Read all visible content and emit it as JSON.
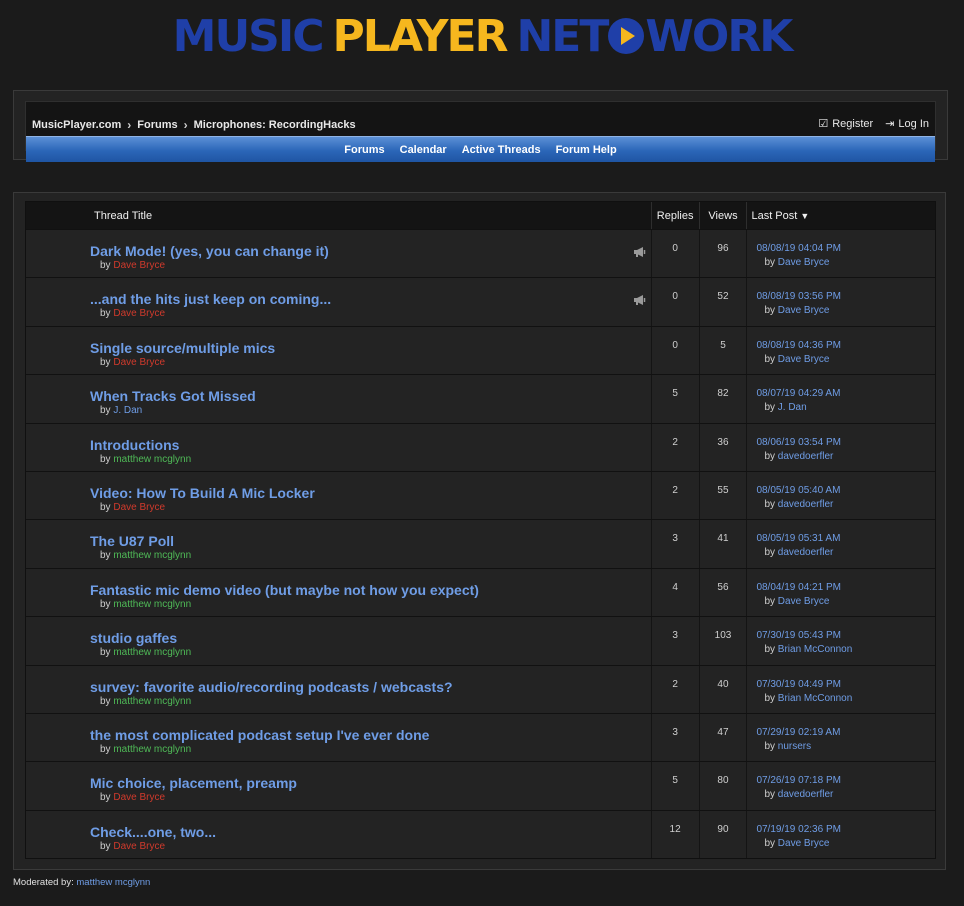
{
  "logo": {
    "word1": "MUSIC",
    "word2": "PLAYER",
    "word3a": "NET",
    "word3b": "WORK"
  },
  "breadcrumb": [
    "MusicPlayer.com",
    "Forums",
    "Microphones: RecordingHacks"
  ],
  "auth": {
    "register": "Register",
    "login": "Log In"
  },
  "nav": [
    "Forums",
    "Calendar",
    "Active Threads",
    "Forum Help"
  ],
  "columns": {
    "title": "Thread Title",
    "replies": "Replies",
    "views": "Views",
    "last_post": "Last Post"
  },
  "threads": [
    {
      "title": "Dark Mode! (yes, you can change it)",
      "by": "by",
      "author": "Dave Bryce",
      "author_color": "red",
      "announce": true,
      "replies": "0",
      "views": "96",
      "last_date": "08/08/19 04:04 PM",
      "last_by": "Dave Bryce"
    },
    {
      "title": "...and the hits just keep on coming...",
      "by": "by",
      "author": "Dave Bryce",
      "author_color": "red",
      "announce": true,
      "replies": "0",
      "views": "52",
      "last_date": "08/08/19 03:56 PM",
      "last_by": "Dave Bryce"
    },
    {
      "title": "Single source/multiple mics",
      "by": "by",
      "author": "Dave Bryce",
      "author_color": "red",
      "announce": false,
      "replies": "0",
      "views": "5",
      "last_date": "08/08/19 04:36 PM",
      "last_by": "Dave Bryce"
    },
    {
      "title": "When Tracks Got Missed",
      "by": "by",
      "author": "J. Dan",
      "author_color": "blue",
      "announce": false,
      "replies": "5",
      "views": "82",
      "last_date": "08/07/19 04:29 AM",
      "last_by": "J. Dan"
    },
    {
      "title": "Introductions",
      "by": "by",
      "author": "matthew mcglynn",
      "author_color": "green",
      "announce": false,
      "replies": "2",
      "views": "36",
      "last_date": "08/06/19 03:54 PM",
      "last_by": "davedoerfler"
    },
    {
      "title": "Video: How To Build A Mic Locker",
      "by": "by",
      "author": "Dave Bryce",
      "author_color": "red",
      "announce": false,
      "replies": "2",
      "views": "55",
      "last_date": "08/05/19 05:40 AM",
      "last_by": "davedoerfler"
    },
    {
      "title": "The U87 Poll",
      "by": "by",
      "author": "matthew mcglynn",
      "author_color": "green",
      "announce": false,
      "replies": "3",
      "views": "41",
      "last_date": "08/05/19 05:31 AM",
      "last_by": "davedoerfler"
    },
    {
      "title": "Fantastic mic demo video (but maybe not how you expect)",
      "by": "by",
      "author": "matthew mcglynn",
      "author_color": "green",
      "announce": false,
      "replies": "4",
      "views": "56",
      "last_date": "08/04/19 04:21 PM",
      "last_by": "Dave Bryce"
    },
    {
      "title": "studio gaffes",
      "by": "by",
      "author": "matthew mcglynn",
      "author_color": "green",
      "announce": false,
      "replies": "3",
      "views": "103",
      "last_date": "07/30/19 05:43 PM",
      "last_by": "Brian McConnon"
    },
    {
      "title": "survey: favorite audio/recording podcasts / webcasts?",
      "by": "by",
      "author": "matthew mcglynn",
      "author_color": "green",
      "announce": false,
      "replies": "2",
      "views": "40",
      "last_date": "07/30/19 04:49 PM",
      "last_by": "Brian McConnon"
    },
    {
      "title": "the most complicated podcast setup I've ever done",
      "by": "by",
      "author": "matthew mcglynn",
      "author_color": "green",
      "announce": false,
      "replies": "3",
      "views": "47",
      "last_date": "07/29/19 02:19 AM",
      "last_by": "nursers"
    },
    {
      "title": "Mic choice, placement, preamp",
      "by": "by",
      "author": "Dave Bryce",
      "author_color": "red",
      "announce": false,
      "replies": "5",
      "views": "80",
      "last_date": "07/26/19 07:18 PM",
      "last_by": "davedoerfler"
    },
    {
      "title": "Check....one, two...",
      "by": "by",
      "author": "Dave Bryce",
      "author_color": "red",
      "announce": false,
      "replies": "12",
      "views": "90",
      "last_date": "07/19/19 02:36 PM",
      "last_by": "Dave Bryce"
    }
  ],
  "moderated": {
    "label": "Moderated by:",
    "name": "matthew mcglynn"
  },
  "colors": {
    "link": "#6f9de6",
    "author_red": "#d03a2c",
    "author_green": "#4fba57",
    "brand_blue": "#1f3fa8",
    "brand_yellow": "#f6b71e"
  },
  "icons": {
    "announcement": "megaphone-icon",
    "register": "checkbox-icon",
    "login": "login-arrow-icon",
    "breadcrumb_sep": "chevron-right-icon",
    "sort": "caret-down-icon"
  }
}
